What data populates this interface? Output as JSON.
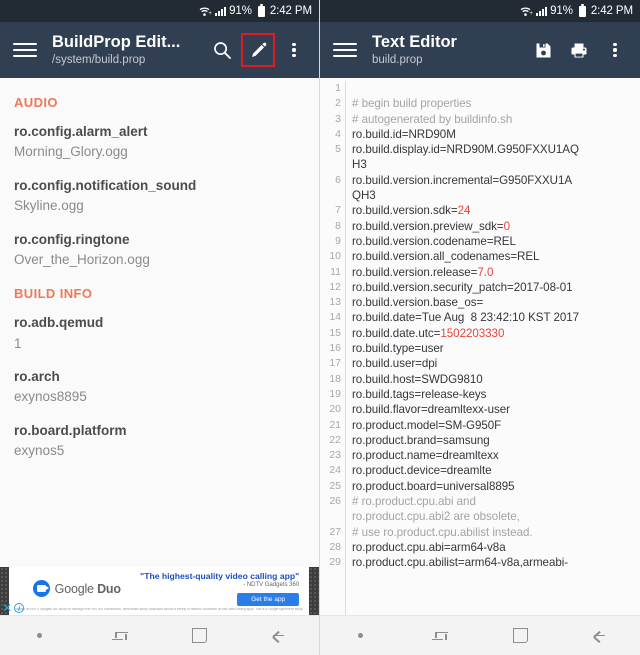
{
  "status_bar": {
    "battery_percent": "91%",
    "time": "2:42 PM",
    "icons": [
      "wifi-icon",
      "signal-icon",
      "battery-icon"
    ]
  },
  "left_panel": {
    "toolbar": {
      "menu_icon": "hamburger-menu-icon",
      "title": "BuildProp Edit...",
      "subtitle": "/system/build.prop",
      "search_icon": "search-icon",
      "edit_icon": "pencil-edit-icon",
      "overflow_icon": "three-dots-overflow-icon"
    },
    "sections": [
      {
        "header": "AUDIO",
        "props": [
          {
            "key": "ro.config.alarm_alert",
            "value": "Morning_Glory.ogg"
          },
          {
            "key": "ro.config.notification_sound",
            "value": "Skyline.ogg"
          },
          {
            "key": "ro.config.ringtone",
            "value": "Over_the_Horizon.ogg"
          }
        ]
      },
      {
        "header": "BUILD INFO",
        "props": [
          {
            "key": "ro.adb.qemud",
            "value": "1"
          },
          {
            "key": "ro.arch",
            "value": "exynos8895"
          },
          {
            "key": "ro.board.platform",
            "value": "exynos5"
          }
        ]
      }
    ],
    "ad": {
      "headline": "\"The highest-quality video calling app\"",
      "citation": "- NDTV Gadgets 360",
      "brand_light": "Google",
      "brand_bold": "Duo",
      "cta": "Get the app",
      "fine_print": "*Based on NDTV Gadgets 360 study for average over 900,000 connections. Benchmark study conducted across a variety of network conditions on two video calling apps. This is a Google sponsored study.",
      "close_label": "✕",
      "info_label": "i"
    }
  },
  "right_panel": {
    "toolbar": {
      "menu_icon": "hamburger-menu-icon",
      "title": "Text Editor",
      "subtitle": "build.prop",
      "save_icon": "floppy-save-icon",
      "print_icon": "printer-icon",
      "overflow_icon": "three-dots-overflow-icon"
    },
    "editor": {
      "lines": [
        {
          "n": "1",
          "rows": [
            {
              "text": "",
              "kind": "plain"
            }
          ]
        },
        {
          "n": "2",
          "rows": [
            {
              "text": "# begin build properties",
              "kind": "comment"
            }
          ]
        },
        {
          "n": "3",
          "rows": [
            {
              "text": "# autogenerated by buildinfo.sh",
              "kind": "comment"
            }
          ]
        },
        {
          "n": "4",
          "rows": [
            {
              "text": "ro.build.id=NRD90M",
              "kind": "plain"
            }
          ]
        },
        {
          "n": "5",
          "rows": [
            {
              "text": "ro.build.display.id=NRD90M.G950FXXU1AQ",
              "kind": "plain"
            },
            {
              "text": "H3",
              "kind": "plain"
            }
          ]
        },
        {
          "n": "6",
          "rows": [
            {
              "text": "ro.build.version.incremental=G950FXXU1A",
              "kind": "plain"
            },
            {
              "text": "QH3",
              "kind": "plain"
            }
          ]
        },
        {
          "n": "7",
          "rows": [
            {
              "text": "ro.build.version.sdk=",
              "kind": "plain",
              "num": "24"
            }
          ]
        },
        {
          "n": "8",
          "rows": [
            {
              "text": "ro.build.version.preview_sdk=",
              "kind": "plain",
              "num": "0"
            }
          ]
        },
        {
          "n": "9",
          "rows": [
            {
              "text": "ro.build.version.codename=REL",
              "kind": "plain"
            }
          ]
        },
        {
          "n": "10",
          "rows": [
            {
              "text": "ro.build.version.all_codenames=REL",
              "kind": "plain"
            }
          ]
        },
        {
          "n": "11",
          "rows": [
            {
              "text": "ro.build.version.release=",
              "kind": "plain",
              "num": "7.0"
            }
          ]
        },
        {
          "n": "12",
          "rows": [
            {
              "text": "ro.build.version.security_patch=2017-08-01",
              "kind": "plain"
            }
          ]
        },
        {
          "n": "13",
          "rows": [
            {
              "text": "ro.build.version.base_os=",
              "kind": "plain"
            }
          ]
        },
        {
          "n": "14",
          "rows": [
            {
              "text": "ro.build.date=Tue Aug  8 23:42:10 KST 2017",
              "kind": "plain"
            }
          ]
        },
        {
          "n": "15",
          "rows": [
            {
              "text": "ro.build.date.utc=",
              "kind": "plain",
              "num": "1502203330"
            }
          ]
        },
        {
          "n": "16",
          "rows": [
            {
              "text": "ro.build.type=user",
              "kind": "plain"
            }
          ]
        },
        {
          "n": "17",
          "rows": [
            {
              "text": "ro.build.user=dpi",
              "kind": "plain"
            }
          ]
        },
        {
          "n": "18",
          "rows": [
            {
              "text": "ro.build.host=SWDG9810",
              "kind": "plain"
            }
          ]
        },
        {
          "n": "19",
          "rows": [
            {
              "text": "ro.build.tags=release-keys",
              "kind": "plain"
            }
          ]
        },
        {
          "n": "20",
          "rows": [
            {
              "text": "ro.build.flavor=dreamltexx-user",
              "kind": "plain"
            }
          ]
        },
        {
          "n": "21",
          "rows": [
            {
              "text": "ro.product.model=SM-G950F",
              "kind": "plain"
            }
          ]
        },
        {
          "n": "22",
          "rows": [
            {
              "text": "ro.product.brand=samsung",
              "kind": "plain"
            }
          ]
        },
        {
          "n": "23",
          "rows": [
            {
              "text": "ro.product.name=dreamltexx",
              "kind": "plain"
            }
          ]
        },
        {
          "n": "24",
          "rows": [
            {
              "text": "ro.product.device=dreamlte",
              "kind": "plain"
            }
          ]
        },
        {
          "n": "25",
          "rows": [
            {
              "text": "ro.product.board=universal8895",
              "kind": "plain"
            }
          ]
        },
        {
          "n": "26",
          "rows": [
            {
              "text": "# ro.product.cpu.abi and",
              "kind": "comment"
            },
            {
              "text": "ro.product.cpu.abi2 are obsolete,",
              "kind": "comment"
            }
          ]
        },
        {
          "n": "27",
          "rows": [
            {
              "text": "# use ro.product.cpu.abilist instead.",
              "kind": "comment"
            }
          ]
        },
        {
          "n": "28",
          "rows": [
            {
              "text": "ro.product.cpu.abi=arm64-v8a",
              "kind": "plain"
            }
          ]
        },
        {
          "n": "29",
          "rows": [
            {
              "text": "ro.product.cpu.abilist=arm64-v8a,armeabi-",
              "kind": "plain"
            }
          ]
        }
      ]
    }
  },
  "nav_bar": {
    "items": [
      "dot-indicator",
      "recents-icon",
      "home-icon",
      "back-icon"
    ]
  },
  "colors": {
    "toolbar": "#303f51",
    "status_bar": "#222a33",
    "section_header": "#f0785a",
    "highlight_border": "#e01b24",
    "syntax_number": "#e8443a"
  }
}
